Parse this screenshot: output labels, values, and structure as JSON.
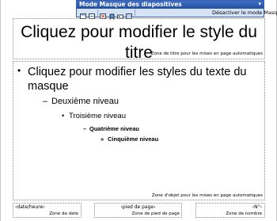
{
  "toolbar": {
    "title": "Mode Masque des diapositives",
    "close_master_label": "Désactiver le mode Masque",
    "icons": [
      "insert-slide-master-icon",
      "insert-title-master-icon",
      "delete-master-icon",
      "preserve-master-icon",
      "rename-master-icon",
      "master-layout-icon"
    ]
  },
  "slide": {
    "title_text": "Cliquez pour modifier le style du titre",
    "title_zone_label": "Zone de titre pour les mises en page automatiques",
    "body": {
      "level1": "Cliquez pour modifier les styles du texte du masque",
      "level2": "Deuxième niveau",
      "level3": "Troisième niveau",
      "level4": "Quatrième niveau",
      "level5": "Cinquième niveau",
      "bullets": [
        "•",
        "–",
        "•",
        "–",
        "»"
      ]
    },
    "object_zone_label": "Zone d'objet pour les mises en page automatiques",
    "date": {
      "field": "‹date/heure›",
      "label": "Zone de date"
    },
    "footer": {
      "field": "‹pied de page›",
      "label": "Zone de pied de page"
    },
    "number": {
      "field": "‹N°›",
      "label": "Zone de nombre"
    }
  }
}
